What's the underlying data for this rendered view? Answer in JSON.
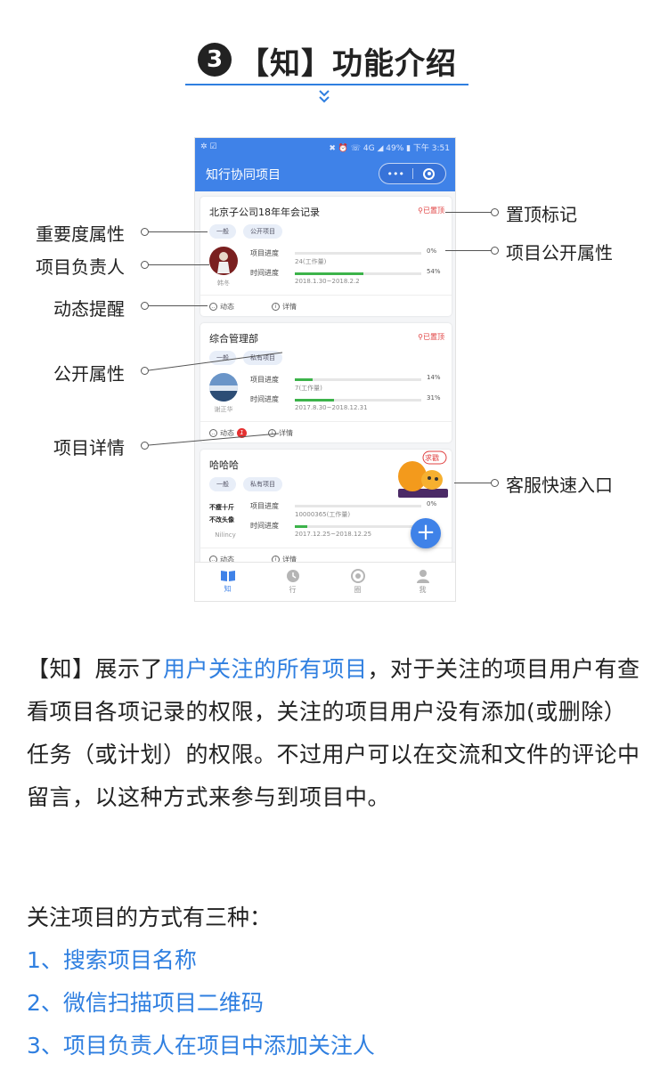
{
  "header": {
    "step_number": "3",
    "title": "【知】功能介绍"
  },
  "phone": {
    "status_left": "✲ ☑",
    "status_right": "✖ ⏰ ☏ 4G ◢ 49% ▮ 下午 3:51",
    "nav_title": "知行协同项目",
    "capsule_more": "•••",
    "cards": [
      {
        "title": "北京子公司18年年会记录",
        "pin_label": "已置顶",
        "tags": [
          "一般",
          "公开项目"
        ],
        "owner": "韩冬",
        "project_progress_label": "项目进度",
        "project_progress_pct": "0%",
        "project_progress_value": 0,
        "workload": "24(工作量)",
        "time_progress_label": "时间进度",
        "time_progress_pct": "54%",
        "time_progress_value": 0.54,
        "date_range": "2018.1.30~2018.2.2",
        "dynamic_label": "动态",
        "detail_label": "详情"
      },
      {
        "title": "综合管理部",
        "pin_label": "已置顶",
        "tags": [
          "一般",
          "私有项目"
        ],
        "owner": "谢正华",
        "project_progress_label": "项目进度",
        "project_progress_pct": "14%",
        "project_progress_value": 0.14,
        "workload": "7(工作量)",
        "time_progress_label": "时间进度",
        "time_progress_pct": "31%",
        "time_progress_value": 0.31,
        "date_range": "2017.8.30~2018.12.31",
        "dynamic_label": "动态",
        "dynamic_badge": "1",
        "detail_label": "详情"
      },
      {
        "title": "哈哈哈",
        "tags": [
          "一般",
          "私有项目"
        ],
        "owner_line1": "不瘦十斤",
        "owner_line2": "不改头像",
        "owner": "Nilincy",
        "project_progress_label": "项目进度",
        "project_progress_pct": "0%",
        "project_progress_value": 0,
        "workload": "10000365(工作量)",
        "time_progress_label": "时间进度",
        "time_progress_value": 0.1,
        "date_range": "2017.12.25~2018.12.25",
        "dynamic_label": "动态",
        "detail_label": "详情",
        "mascot_text": "求戳"
      }
    ],
    "fab_label": "+",
    "tabs": [
      {
        "label": "知",
        "icon": "book-icon",
        "active": true
      },
      {
        "label": "行",
        "icon": "clock-icon",
        "active": false
      },
      {
        "label": "圈",
        "icon": "aperture-icon",
        "active": false
      },
      {
        "label": "我",
        "icon": "person-icon",
        "active": false
      }
    ]
  },
  "callouts": {
    "importance": "重要度属性",
    "owner": "项目负责人",
    "dynamic": "动态提醒",
    "public": "公开属性",
    "detail": "项目详情",
    "pin": "置顶标记",
    "project_public": "项目公开属性",
    "service": "客服快速入口"
  },
  "description": {
    "p1_a": "【知】展示了",
    "p1_highlight": "用户关注的所有项目",
    "p1_b": "，对于关注的项目用户有查看项目各项记录的权限，关注的项目用户没有添加(或删除）任务（或计划）的权限。不过用户可以在交流和文件的评论中留言，以这种方式来参与到项目中。",
    "ways_intro": "关注项目的方式有三种：",
    "ways": [
      "1、搜索项目名称",
      "2、微信扫描项目二维码",
      "3、项目负责人在项目中添加关注人"
    ]
  }
}
